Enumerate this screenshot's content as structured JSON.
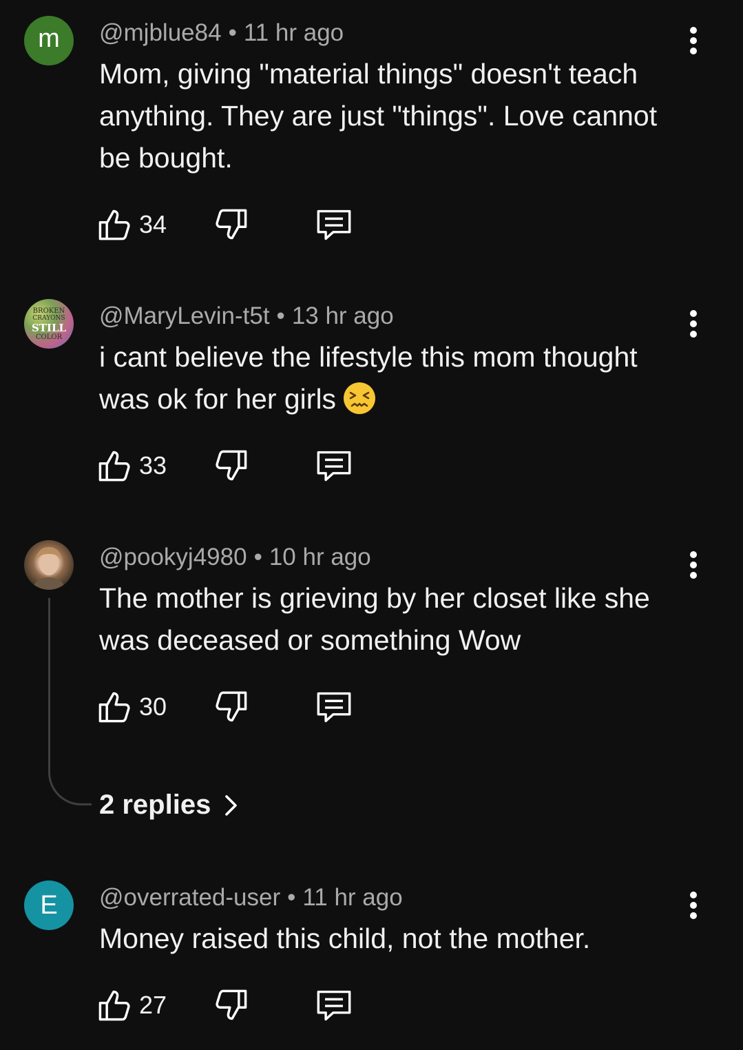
{
  "comments": [
    {
      "author": "@mjblue84",
      "time": "11 hr ago",
      "avatar_letter": "m",
      "avatar_color": "#3c7b29",
      "lines": [
        "Mom, giving \"material things\" doesn't teach",
        "anything.  They are just \"things\".  Love cannot",
        "be bought."
      ],
      "likes": "34"
    },
    {
      "author": "@MaryLevin-t5t",
      "time": "13 hr ago",
      "avatar_text": [
        "BROKEN",
        "CRAYONS",
        "STILL",
        "COLOR"
      ],
      "lines": [
        "i cant believe the lifestyle this mom thought",
        "was ok for her girls"
      ],
      "emoji": "confounded-face",
      "likes": "33"
    },
    {
      "author": "@pookyj4980",
      "time": "10 hr ago",
      "lines": [
        "The mother is grieving by her closet like she",
        "was deceased or something Wow"
      ],
      "likes": "30",
      "replies_label": "2 replies"
    },
    {
      "author": "@overrated-user",
      "time": "11 hr ago",
      "avatar_letter": "E",
      "avatar_color": "#1593a3",
      "lines": [
        "Money raised this child, not the mother."
      ],
      "likes": "27"
    }
  ],
  "separator": "•"
}
